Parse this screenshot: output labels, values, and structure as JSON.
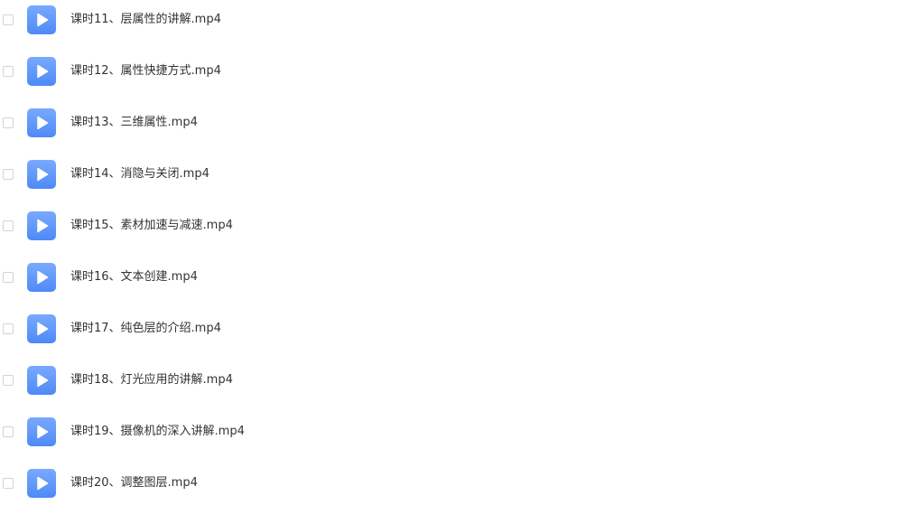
{
  "files": [
    {
      "name": "课时11、层属性的讲解.mp4",
      "icon": "play-video-icon"
    },
    {
      "name": "课时12、属性快捷方式.mp4",
      "icon": "play-video-icon"
    },
    {
      "name": "课时13、三维属性.mp4",
      "icon": "play-video-icon"
    },
    {
      "name": "课时14、消隐与关闭.mp4",
      "icon": "play-video-icon"
    },
    {
      "name": "课时15、素材加速与减速.mp4",
      "icon": "play-video-icon"
    },
    {
      "name": "课时16、文本创建.mp4",
      "icon": "play-video-icon"
    },
    {
      "name": "课时17、纯色层的介绍.mp4",
      "icon": "play-video-icon"
    },
    {
      "name": "课时18、灯光应用的讲解.mp4",
      "icon": "play-video-icon"
    },
    {
      "name": "课时19、摄像机的深入讲解.mp4",
      "icon": "play-video-icon"
    },
    {
      "name": "课时20、调整图层.mp4",
      "icon": "play-video-icon"
    }
  ],
  "colors": {
    "icon_top": "#79aaff",
    "icon_bottom": "#4e89f7",
    "text": "#333333",
    "checkbox_border": "#d3d3d3"
  }
}
